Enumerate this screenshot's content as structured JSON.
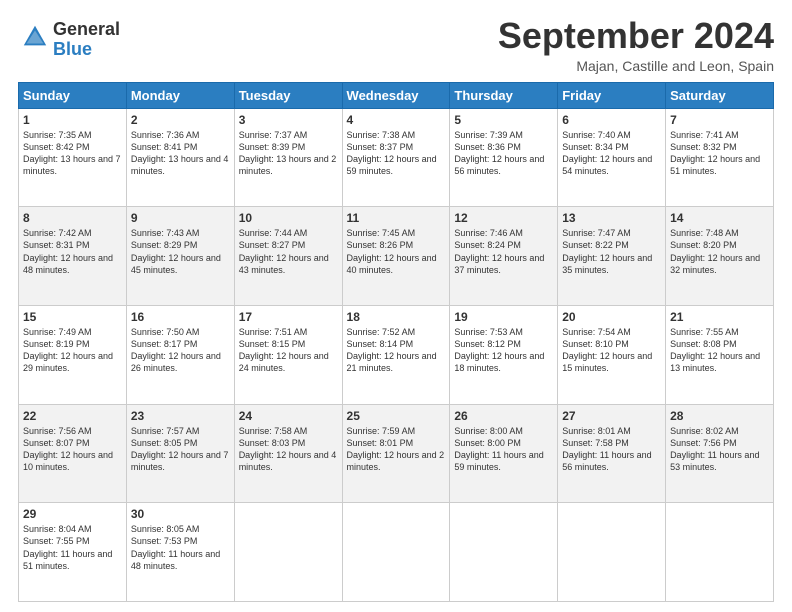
{
  "logo": {
    "general": "General",
    "blue": "Blue"
  },
  "header": {
    "month": "September 2024",
    "location": "Majan, Castille and Leon, Spain"
  },
  "days_of_week": [
    "Sunday",
    "Monday",
    "Tuesday",
    "Wednesday",
    "Thursday",
    "Friday",
    "Saturday"
  ],
  "weeks": [
    [
      {
        "day": 1,
        "sunrise": "7:35 AM",
        "sunset": "8:42 PM",
        "daylight": "13 hours and 7 minutes"
      },
      {
        "day": 2,
        "sunrise": "7:36 AM",
        "sunset": "8:41 PM",
        "daylight": "13 hours and 4 minutes"
      },
      {
        "day": 3,
        "sunrise": "7:37 AM",
        "sunset": "8:39 PM",
        "daylight": "13 hours and 2 minutes"
      },
      {
        "day": 4,
        "sunrise": "7:38 AM",
        "sunset": "8:37 PM",
        "daylight": "12 hours and 59 minutes"
      },
      {
        "day": 5,
        "sunrise": "7:39 AM",
        "sunset": "8:36 PM",
        "daylight": "12 hours and 56 minutes"
      },
      {
        "day": 6,
        "sunrise": "7:40 AM",
        "sunset": "8:34 PM",
        "daylight": "12 hours and 54 minutes"
      },
      {
        "day": 7,
        "sunrise": "7:41 AM",
        "sunset": "8:32 PM",
        "daylight": "12 hours and 51 minutes"
      }
    ],
    [
      {
        "day": 8,
        "sunrise": "7:42 AM",
        "sunset": "8:31 PM",
        "daylight": "12 hours and 48 minutes"
      },
      {
        "day": 9,
        "sunrise": "7:43 AM",
        "sunset": "8:29 PM",
        "daylight": "12 hours and 45 minutes"
      },
      {
        "day": 10,
        "sunrise": "7:44 AM",
        "sunset": "8:27 PM",
        "daylight": "12 hours and 43 minutes"
      },
      {
        "day": 11,
        "sunrise": "7:45 AM",
        "sunset": "8:26 PM",
        "daylight": "12 hours and 40 minutes"
      },
      {
        "day": 12,
        "sunrise": "7:46 AM",
        "sunset": "8:24 PM",
        "daylight": "12 hours and 37 minutes"
      },
      {
        "day": 13,
        "sunrise": "7:47 AM",
        "sunset": "8:22 PM",
        "daylight": "12 hours and 35 minutes"
      },
      {
        "day": 14,
        "sunrise": "7:48 AM",
        "sunset": "8:20 PM",
        "daylight": "12 hours and 32 minutes"
      }
    ],
    [
      {
        "day": 15,
        "sunrise": "7:49 AM",
        "sunset": "8:19 PM",
        "daylight": "12 hours and 29 minutes"
      },
      {
        "day": 16,
        "sunrise": "7:50 AM",
        "sunset": "8:17 PM",
        "daylight": "12 hours and 26 minutes"
      },
      {
        "day": 17,
        "sunrise": "7:51 AM",
        "sunset": "8:15 PM",
        "daylight": "12 hours and 24 minutes"
      },
      {
        "day": 18,
        "sunrise": "7:52 AM",
        "sunset": "8:14 PM",
        "daylight": "12 hours and 21 minutes"
      },
      {
        "day": 19,
        "sunrise": "7:53 AM",
        "sunset": "8:12 PM",
        "daylight": "12 hours and 18 minutes"
      },
      {
        "day": 20,
        "sunrise": "7:54 AM",
        "sunset": "8:10 PM",
        "daylight": "12 hours and 15 minutes"
      },
      {
        "day": 21,
        "sunrise": "7:55 AM",
        "sunset": "8:08 PM",
        "daylight": "12 hours and 13 minutes"
      }
    ],
    [
      {
        "day": 22,
        "sunrise": "7:56 AM",
        "sunset": "8:07 PM",
        "daylight": "12 hours and 10 minutes"
      },
      {
        "day": 23,
        "sunrise": "7:57 AM",
        "sunset": "8:05 PM",
        "daylight": "12 hours and 7 minutes"
      },
      {
        "day": 24,
        "sunrise": "7:58 AM",
        "sunset": "8:03 PM",
        "daylight": "12 hours and 4 minutes"
      },
      {
        "day": 25,
        "sunrise": "7:59 AM",
        "sunset": "8:01 PM",
        "daylight": "12 hours and 2 minutes"
      },
      {
        "day": 26,
        "sunrise": "8:00 AM",
        "sunset": "8:00 PM",
        "daylight": "11 hours and 59 minutes"
      },
      {
        "day": 27,
        "sunrise": "8:01 AM",
        "sunset": "7:58 PM",
        "daylight": "11 hours and 56 minutes"
      },
      {
        "day": 28,
        "sunrise": "8:02 AM",
        "sunset": "7:56 PM",
        "daylight": "11 hours and 53 minutes"
      }
    ],
    [
      {
        "day": 29,
        "sunrise": "8:04 AM",
        "sunset": "7:55 PM",
        "daylight": "11 hours and 51 minutes"
      },
      {
        "day": 30,
        "sunrise": "8:05 AM",
        "sunset": "7:53 PM",
        "daylight": "11 hours and 48 minutes"
      },
      null,
      null,
      null,
      null,
      null
    ]
  ]
}
